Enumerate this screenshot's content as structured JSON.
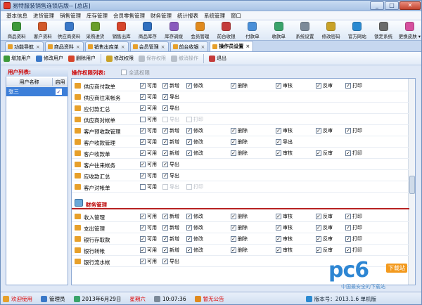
{
  "window": {
    "title": "易特服装销售连锁店版-- [总店]",
    "minimize": "_",
    "maximize": "□",
    "close": "✕"
  },
  "menu": [
    "基本信息",
    "进货管理",
    "销售管理",
    "库存管理",
    "会员零售管理",
    "财务管理",
    "统计报表",
    "系统管理",
    "窗口"
  ],
  "toolbar": {
    "items": [
      {
        "label": "商品资料",
        "color": "#3e9a3a"
      },
      {
        "label": "客户资料",
        "color": "#d2592a"
      },
      {
        "label": "供应商资料",
        "color": "#3a78c8"
      },
      {
        "label": "采购进货",
        "color": "#6a9e2b"
      },
      {
        "label": "销售出库",
        "color": "#d6452b"
      },
      {
        "label": "商品库存",
        "color": "#2f6fbf"
      },
      {
        "label": "库存调拨",
        "color": "#8a5bbd"
      },
      {
        "label": "会员管理",
        "color": "#e08a1e"
      },
      {
        "label": "前台收银",
        "color": "#c43b3b"
      },
      {
        "label": "付款单",
        "color": "#4a8fd8"
      },
      {
        "label": "收款单",
        "color": "#3aa36a"
      },
      {
        "label": "系统设置",
        "color": "#7c8a99"
      },
      {
        "label": "修改密码",
        "color": "#c9a227"
      },
      {
        "label": "官方网站",
        "color": "#2b8ad1"
      },
      {
        "label": "锁定系统",
        "color": "#6b6b6b"
      },
      {
        "label": "更换皮肤",
        "color": "#d64f9e"
      }
    ]
  },
  "tabs": [
    {
      "label": "功能导航",
      "active": false
    },
    {
      "label": "商品资料",
      "active": false
    },
    {
      "label": "销售出库单",
      "active": false
    },
    {
      "label": "会员管理",
      "active": false
    },
    {
      "label": "前台收银",
      "active": false
    },
    {
      "label": "操作员设置",
      "active": true
    }
  ],
  "actions": {
    "add_user": "增加用户",
    "edit_user": "修改用户",
    "delete_user": "删除用户",
    "edit_perm": "修改权限",
    "save_perm": "保存权限",
    "cancel": "撤消操作",
    "exit": "退出"
  },
  "users": {
    "panel_title": "用户列表:",
    "col_name": "用户名称",
    "col_enabled": "启用",
    "rows": [
      {
        "name": "张三",
        "enabled": true
      }
    ]
  },
  "perms": {
    "title": "操作权限列表:",
    "select_all": "全选权限",
    "rows": [
      {
        "name": "供应商付款单",
        "perms": [
          [
            "可用",
            true
          ],
          [
            "新增",
            true
          ],
          [
            "修改",
            true
          ],
          [
            "删除",
            true
          ],
          [
            "审核",
            true
          ],
          [
            "反审",
            true
          ],
          [
            "打印",
            true
          ]
        ]
      },
      {
        "name": "供应商往来帐务",
        "perms": [
          [
            "可用",
            true
          ],
          [
            "导出",
            true
          ]
        ]
      },
      {
        "name": "应付款汇总",
        "perms": [
          [
            "可用",
            true
          ],
          [
            "导出",
            true
          ]
        ]
      },
      {
        "name": "供应商对帐单",
        "perms": [
          [
            "可用",
            false
          ],
          [
            "导出",
            false,
            true
          ],
          [
            "打印",
            false,
            true
          ]
        ]
      },
      {
        "name": "客户预收款管理",
        "perms": [
          [
            "可用",
            true
          ],
          [
            "新增",
            true
          ],
          [
            "修改",
            true
          ],
          [
            "删除",
            true
          ],
          [
            "审核",
            true
          ],
          [
            "反审",
            true
          ],
          [
            "打印",
            true
          ]
        ]
      },
      {
        "name": "客户收款管理",
        "perms": [
          [
            "可用",
            true
          ],
          [
            "新增",
            true
          ],
          [
            "修改",
            true
          ],
          [
            "删除",
            true
          ],
          [
            "导出",
            true
          ]
        ]
      },
      {
        "name": "客户收款单",
        "perms": [
          [
            "可用",
            true
          ],
          [
            "新增",
            true
          ],
          [
            "修改",
            true
          ],
          [
            "删除",
            true
          ],
          [
            "审核",
            true
          ],
          [
            "反审",
            true
          ],
          [
            "打印",
            true
          ]
        ]
      },
      {
        "name": "客户往来帐务",
        "perms": [
          [
            "可用",
            true
          ],
          [
            "导出",
            true
          ]
        ]
      },
      {
        "name": "应收款汇总",
        "perms": [
          [
            "可用",
            true
          ],
          [
            "导出",
            true
          ]
        ]
      },
      {
        "name": "客户对帐单",
        "perms": [
          [
            "可用",
            false
          ],
          [
            "导出",
            false,
            true
          ],
          [
            "打印",
            false,
            true
          ]
        ]
      }
    ],
    "group": "财务管理",
    "group_rows": [
      {
        "name": "收入管理",
        "perms": [
          [
            "可用",
            true
          ],
          [
            "新增",
            true
          ],
          [
            "修改",
            true
          ],
          [
            "删除",
            true
          ],
          [
            "审核",
            true
          ],
          [
            "反审",
            true
          ],
          [
            "打印",
            true
          ]
        ]
      },
      {
        "name": "支出管理",
        "perms": [
          [
            "可用",
            true
          ],
          [
            "新增",
            true
          ],
          [
            "修改",
            true
          ],
          [
            "删除",
            true
          ],
          [
            "审核",
            true
          ],
          [
            "反审",
            true
          ],
          [
            "打印",
            true
          ]
        ]
      },
      {
        "name": "银行存取款",
        "perms": [
          [
            "可用",
            true
          ],
          [
            "新增",
            true
          ],
          [
            "修改",
            true
          ],
          [
            "删除",
            true
          ],
          [
            "审核",
            true
          ],
          [
            "反审",
            true
          ],
          [
            "打印",
            true
          ]
        ]
      },
      {
        "name": "银行转帐",
        "perms": [
          [
            "可用",
            true
          ],
          [
            "新增",
            true
          ],
          [
            "修改",
            true
          ],
          [
            "删除",
            true
          ],
          [
            "审核",
            true
          ],
          [
            "反审",
            true
          ],
          [
            "打印",
            true
          ]
        ]
      },
      {
        "name": "银行流水帐",
        "perms": [
          [
            "可用",
            true
          ],
          [
            "导出",
            true
          ]
        ]
      }
    ]
  },
  "status": {
    "welcome": "欢迎使用",
    "user": "管理员",
    "date": "2013年6月29日",
    "weekday": "星期六",
    "time": "10:07:36",
    "notice": "暂无公告",
    "version": "版本号：2013.1.6 单机版"
  },
  "watermark": {
    "brand": "pc6",
    "badge": "下载站",
    "sub": "中国最安全的下载站"
  }
}
